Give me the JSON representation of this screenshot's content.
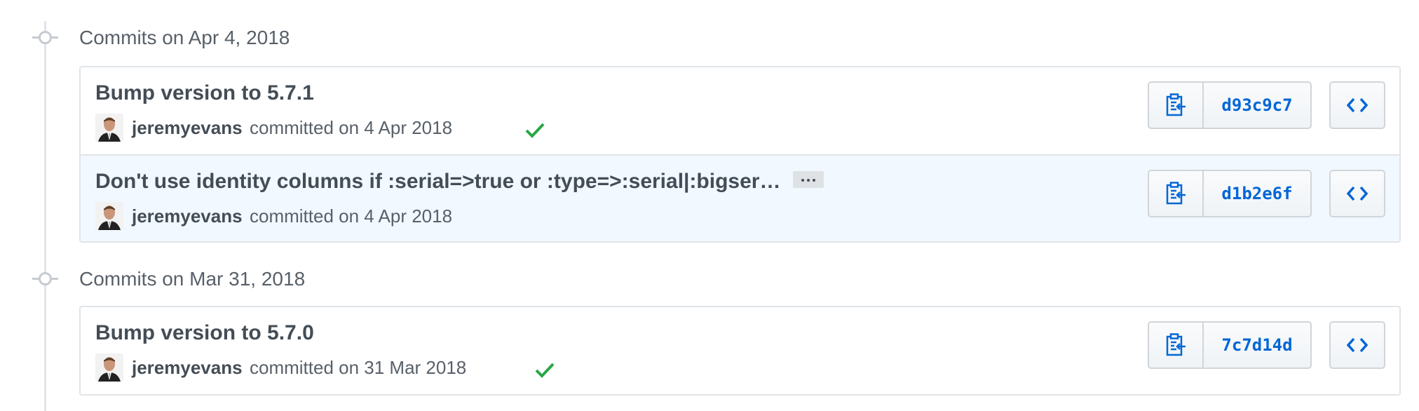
{
  "groups": [
    {
      "date": "Commits on Apr 4, 2018",
      "commits": [
        {
          "message": "Bump version to 5.7.1",
          "author": "jeremyevans",
          "committed": "committed on 4 Apr 2018",
          "verified": true,
          "sha": "d93c9c7",
          "has_ellipsis": false
        },
        {
          "message": "Don't use identity columns if :serial=>true or :type=>:serial|:bigser…",
          "author": "jeremyevans",
          "committed": "committed on 4 Apr 2018",
          "verified": false,
          "sha": "d1b2e6f",
          "has_ellipsis": true
        }
      ]
    },
    {
      "date": "Commits on Mar 31, 2018",
      "commits": [
        {
          "message": "Bump version to 5.7.0",
          "author": "jeremyevans",
          "committed": "committed on 31 Mar 2018",
          "verified": true,
          "sha": "7c7d14d",
          "has_ellipsis": false
        }
      ]
    }
  ],
  "icons": {
    "copy": "clippy-icon",
    "browse": "code-icon",
    "verified": "check-icon",
    "more": "ellipsis-icon"
  },
  "colors": {
    "link": "#0366d6",
    "check": "#28a745",
    "highlight": "#f1f8ff"
  }
}
